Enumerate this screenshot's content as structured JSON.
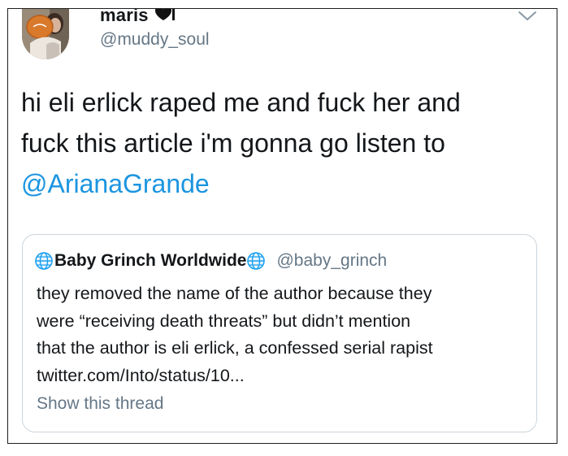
{
  "author": {
    "display_name": "maris",
    "handle": "@muddy_soul"
  },
  "tweet": {
    "lines": [
      "hi eli erlick raped me and fuck her and",
      "fuck this article i'm gonna go listen to"
    ],
    "mention": "@ArianaGrande"
  },
  "quote": {
    "display_name": "Baby Grinch Worldwide",
    "handle": "@baby_grinch",
    "body_lines": [
      "they removed the name of the author because they",
      "were “receiving death threats” but didn’t mention",
      "that the author is eli erlick, a confessed serial rapist",
      "twitter.com/Into/status/10..."
    ],
    "show_thread": "Show this thread"
  },
  "icons": {
    "avatar": "profile-photo",
    "name_emoji": "black-heart-candle-emoji",
    "menu_caret": "chevron-down-icon",
    "globe": "globe-icon"
  },
  "colors": {
    "text": "#14171a",
    "secondary": "#657786",
    "link": "#1b95e0",
    "card_border": "#ccd6dd",
    "globe": "#1da1f2"
  }
}
